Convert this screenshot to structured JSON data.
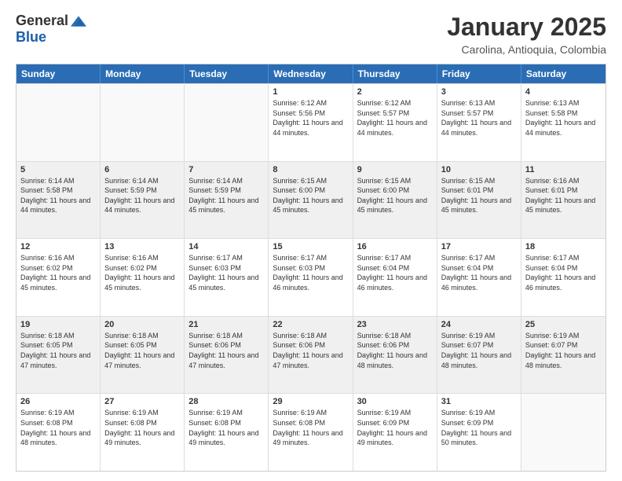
{
  "header": {
    "logo_general": "General",
    "logo_blue": "Blue",
    "month_title": "January 2025",
    "subtitle": "Carolina, Antioquia, Colombia"
  },
  "weekdays": [
    "Sunday",
    "Monday",
    "Tuesday",
    "Wednesday",
    "Thursday",
    "Friday",
    "Saturday"
  ],
  "weeks": [
    [
      {
        "day": "",
        "info": ""
      },
      {
        "day": "",
        "info": ""
      },
      {
        "day": "",
        "info": ""
      },
      {
        "day": "1",
        "info": "Sunrise: 6:12 AM\nSunset: 5:56 PM\nDaylight: 11 hours and 44 minutes."
      },
      {
        "day": "2",
        "info": "Sunrise: 6:12 AM\nSunset: 5:57 PM\nDaylight: 11 hours and 44 minutes."
      },
      {
        "day": "3",
        "info": "Sunrise: 6:13 AM\nSunset: 5:57 PM\nDaylight: 11 hours and 44 minutes."
      },
      {
        "day": "4",
        "info": "Sunrise: 6:13 AM\nSunset: 5:58 PM\nDaylight: 11 hours and 44 minutes."
      }
    ],
    [
      {
        "day": "5",
        "info": "Sunrise: 6:14 AM\nSunset: 5:58 PM\nDaylight: 11 hours and 44 minutes."
      },
      {
        "day": "6",
        "info": "Sunrise: 6:14 AM\nSunset: 5:59 PM\nDaylight: 11 hours and 44 minutes."
      },
      {
        "day": "7",
        "info": "Sunrise: 6:14 AM\nSunset: 5:59 PM\nDaylight: 11 hours and 45 minutes."
      },
      {
        "day": "8",
        "info": "Sunrise: 6:15 AM\nSunset: 6:00 PM\nDaylight: 11 hours and 45 minutes."
      },
      {
        "day": "9",
        "info": "Sunrise: 6:15 AM\nSunset: 6:00 PM\nDaylight: 11 hours and 45 minutes."
      },
      {
        "day": "10",
        "info": "Sunrise: 6:15 AM\nSunset: 6:01 PM\nDaylight: 11 hours and 45 minutes."
      },
      {
        "day": "11",
        "info": "Sunrise: 6:16 AM\nSunset: 6:01 PM\nDaylight: 11 hours and 45 minutes."
      }
    ],
    [
      {
        "day": "12",
        "info": "Sunrise: 6:16 AM\nSunset: 6:02 PM\nDaylight: 11 hours and 45 minutes."
      },
      {
        "day": "13",
        "info": "Sunrise: 6:16 AM\nSunset: 6:02 PM\nDaylight: 11 hours and 45 minutes."
      },
      {
        "day": "14",
        "info": "Sunrise: 6:17 AM\nSunset: 6:03 PM\nDaylight: 11 hours and 45 minutes."
      },
      {
        "day": "15",
        "info": "Sunrise: 6:17 AM\nSunset: 6:03 PM\nDaylight: 11 hours and 46 minutes."
      },
      {
        "day": "16",
        "info": "Sunrise: 6:17 AM\nSunset: 6:04 PM\nDaylight: 11 hours and 46 minutes."
      },
      {
        "day": "17",
        "info": "Sunrise: 6:17 AM\nSunset: 6:04 PM\nDaylight: 11 hours and 46 minutes."
      },
      {
        "day": "18",
        "info": "Sunrise: 6:17 AM\nSunset: 6:04 PM\nDaylight: 11 hours and 46 minutes."
      }
    ],
    [
      {
        "day": "19",
        "info": "Sunrise: 6:18 AM\nSunset: 6:05 PM\nDaylight: 11 hours and 47 minutes."
      },
      {
        "day": "20",
        "info": "Sunrise: 6:18 AM\nSunset: 6:05 PM\nDaylight: 11 hours and 47 minutes."
      },
      {
        "day": "21",
        "info": "Sunrise: 6:18 AM\nSunset: 6:06 PM\nDaylight: 11 hours and 47 minutes."
      },
      {
        "day": "22",
        "info": "Sunrise: 6:18 AM\nSunset: 6:06 PM\nDaylight: 11 hours and 47 minutes."
      },
      {
        "day": "23",
        "info": "Sunrise: 6:18 AM\nSunset: 6:06 PM\nDaylight: 11 hours and 48 minutes."
      },
      {
        "day": "24",
        "info": "Sunrise: 6:19 AM\nSunset: 6:07 PM\nDaylight: 11 hours and 48 minutes."
      },
      {
        "day": "25",
        "info": "Sunrise: 6:19 AM\nSunset: 6:07 PM\nDaylight: 11 hours and 48 minutes."
      }
    ],
    [
      {
        "day": "26",
        "info": "Sunrise: 6:19 AM\nSunset: 6:08 PM\nDaylight: 11 hours and 48 minutes."
      },
      {
        "day": "27",
        "info": "Sunrise: 6:19 AM\nSunset: 6:08 PM\nDaylight: 11 hours and 49 minutes."
      },
      {
        "day": "28",
        "info": "Sunrise: 6:19 AM\nSunset: 6:08 PM\nDaylight: 11 hours and 49 minutes."
      },
      {
        "day": "29",
        "info": "Sunrise: 6:19 AM\nSunset: 6:08 PM\nDaylight: 11 hours and 49 minutes."
      },
      {
        "day": "30",
        "info": "Sunrise: 6:19 AM\nSunset: 6:09 PM\nDaylight: 11 hours and 49 minutes."
      },
      {
        "day": "31",
        "info": "Sunrise: 6:19 AM\nSunset: 6:09 PM\nDaylight: 11 hours and 50 minutes."
      },
      {
        "day": "",
        "info": ""
      }
    ]
  ]
}
